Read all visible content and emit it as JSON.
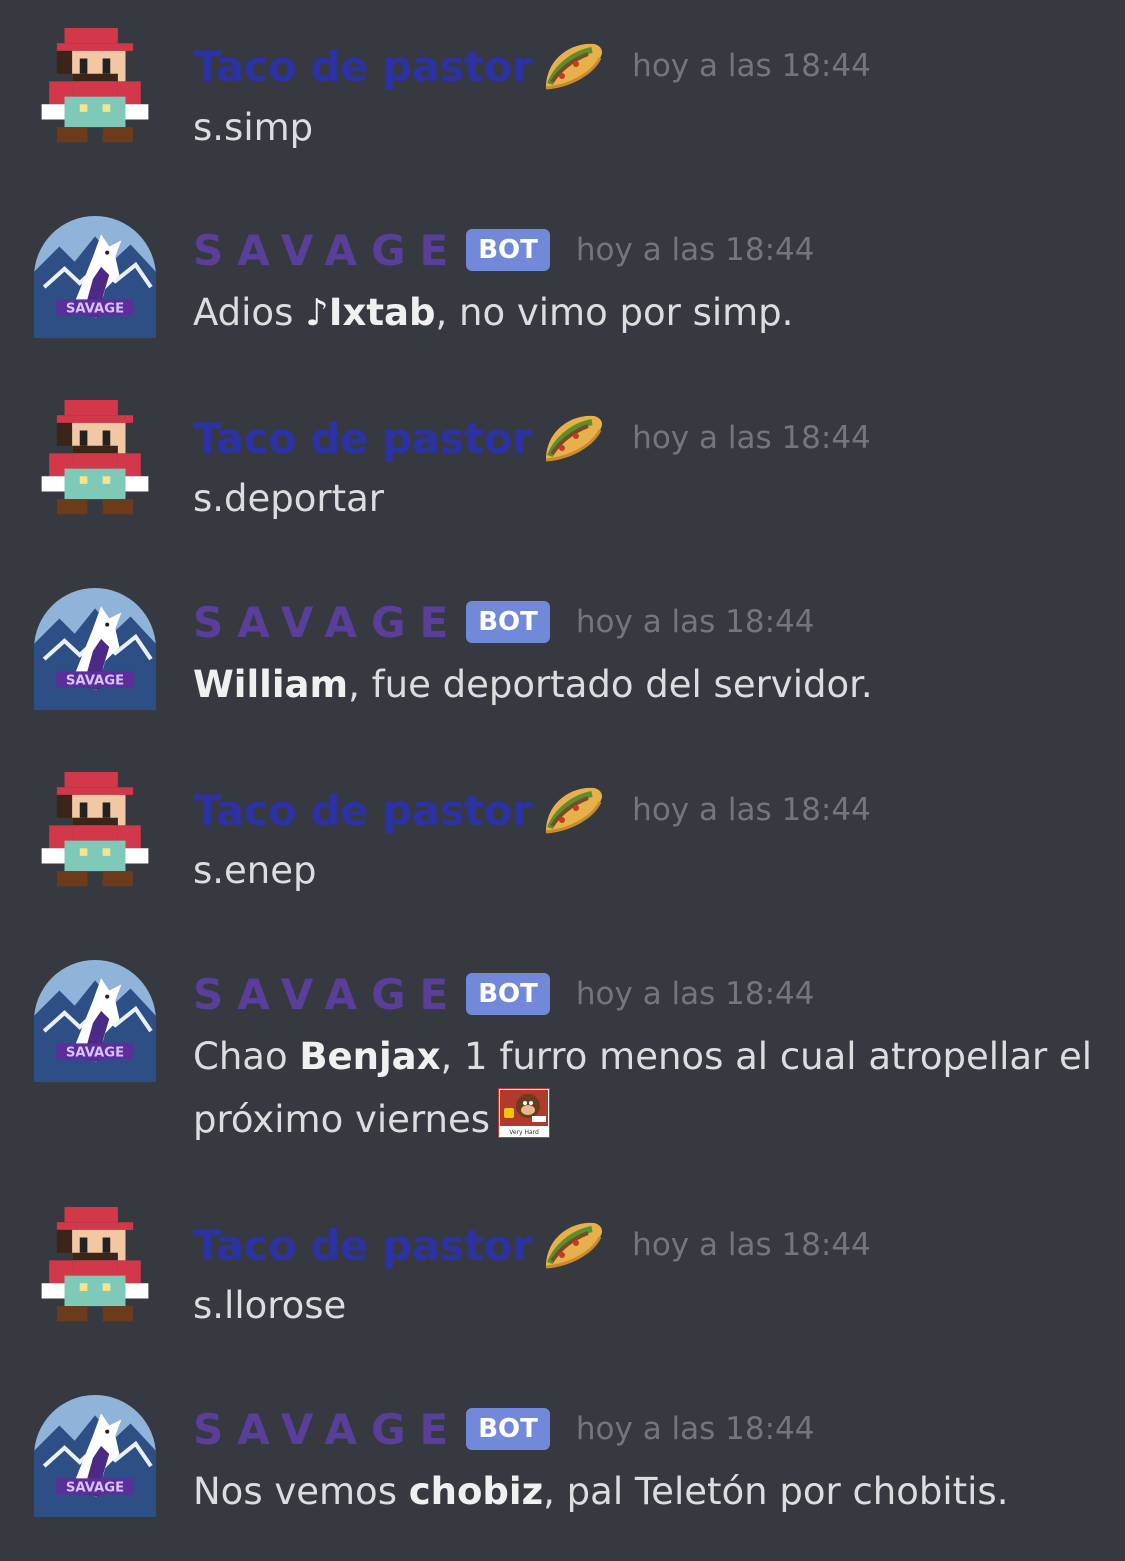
{
  "colors": {
    "background": "#36393f",
    "taco_name": "#2c32a2",
    "bot_name": "#5a3f9a",
    "bot_tag": "#7289da",
    "timestamp": "#72767d",
    "message_text": "#dcddde"
  },
  "users": {
    "taco": {
      "name": "Taco de pastor",
      "avatar_icon": "mario-avatar-icon",
      "name_emoji": "taco-icon"
    },
    "savage": {
      "name": "SAVAGE",
      "avatar_icon": "savage-wolf-avatar-icon",
      "tag": "BOT"
    }
  },
  "messages": [
    {
      "author": "Taco de pastor",
      "timestamp": "hoy a las 18:44",
      "text": "s.simp"
    },
    {
      "author": "SAVAGE",
      "tag": "BOT",
      "timestamp": "hoy a las 18:44",
      "pre": "Adios ",
      "bold": "♪Ixtab",
      "post": ", no vimo por simp."
    },
    {
      "author": "Taco de pastor",
      "timestamp": "hoy a las 18:44",
      "text": "s.deportar"
    },
    {
      "author": "SAVAGE",
      "tag": "BOT",
      "timestamp": "hoy a las 18:44",
      "pre": "",
      "bold": "William",
      "post": ", fue deportado del servidor."
    },
    {
      "author": "Taco de pastor",
      "timestamp": "hoy a las 18:44",
      "text": "s.enep"
    },
    {
      "author": "SAVAGE",
      "tag": "BOT",
      "timestamp": "hoy a las 18:44",
      "pre": "Chao ",
      "bold": "Benjax",
      "post": ", 1 furro menos al cual atropellar el próximo viernes",
      "emoji": "donkey-kong-very-hard-emoji",
      "emoji_caption": "Very Hard"
    },
    {
      "author": "Taco de pastor",
      "timestamp": "hoy a las 18:44",
      "text": "s.llorose"
    },
    {
      "author": "SAVAGE",
      "tag": "BOT",
      "timestamp": "hoy a las 18:44",
      "pre": "Nos vemos ",
      "bold": "chobiz",
      "post": ", pal Teletón por chobitis."
    }
  ]
}
